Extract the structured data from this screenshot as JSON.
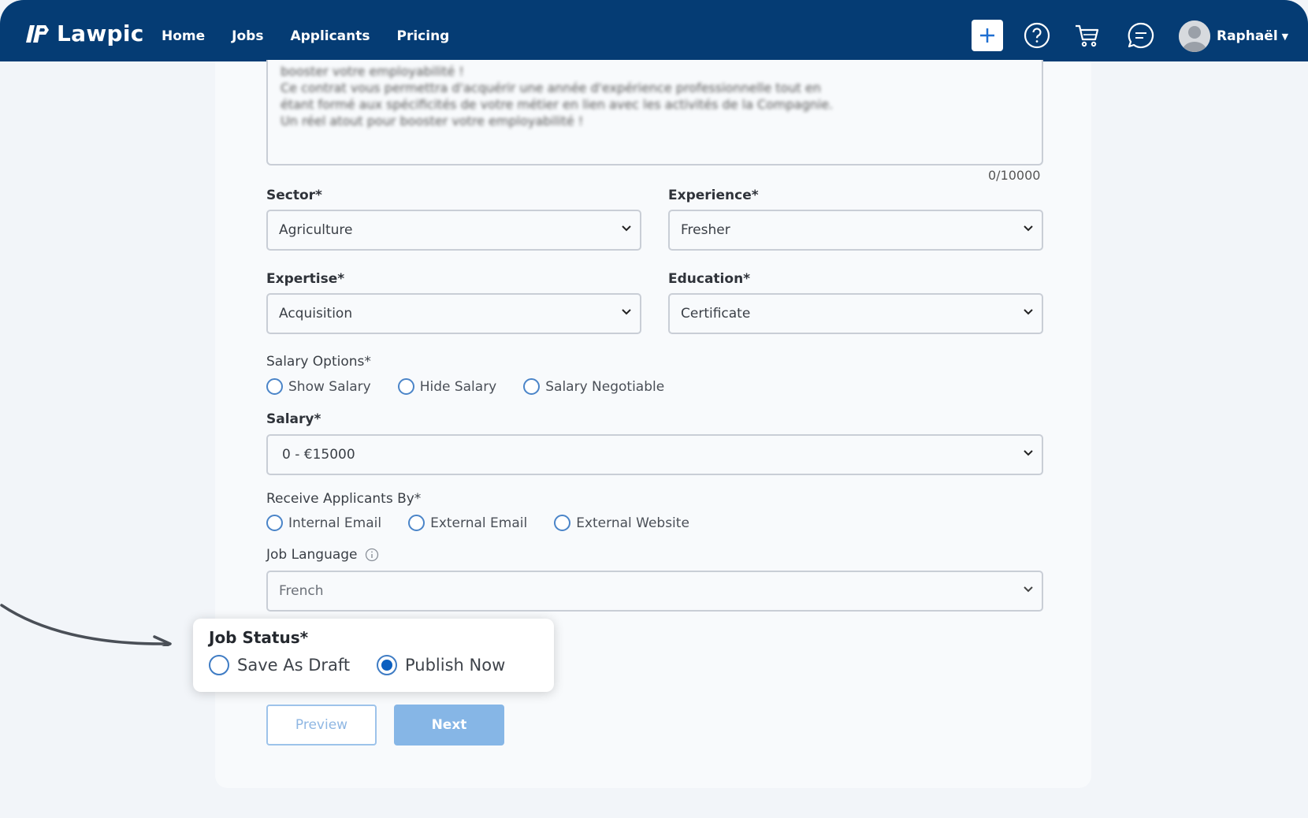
{
  "header": {
    "brand": "Lawpic",
    "nav": [
      "Home",
      "Jobs",
      "Applicants",
      "Pricing"
    ],
    "user_name": "Raphaël",
    "icons": [
      "plus-icon",
      "help-icon",
      "cart-icon",
      "chat-icon",
      "avatar-icon",
      "caret-down-icon"
    ]
  },
  "description": {
    "visible_text": "booster votre employabilité !\nCe contrat vous permettra d'acquérir une année d'expérience professionnelle tout en\nétant formé aux spécificités de votre métier en lien avec les activités de la Compagnie.\nUn réel atout pour booster votre employabilité !",
    "counter": "0/10000"
  },
  "form": {
    "sector": {
      "label": "Sector*",
      "value": "Agriculture"
    },
    "experience": {
      "label": "Experience*",
      "value": "Fresher"
    },
    "expertise": {
      "label": "Expertise*",
      "value": "Acquisition"
    },
    "education": {
      "label": "Education*",
      "value": "Certificate"
    },
    "salary_options": {
      "label": "Salary Options*",
      "options": [
        "Show Salary",
        "Hide Salary",
        "Salary Negotiable"
      ]
    },
    "salary": {
      "label": "Salary*",
      "value": "0 - €15000"
    },
    "receive_applicants": {
      "label": "Receive Applicants By*",
      "options": [
        "Internal Email",
        "External Email",
        "External Website"
      ]
    },
    "job_language": {
      "label": "Job Language",
      "value": "French"
    },
    "job_status": {
      "label": "Job Status*",
      "options": [
        "Save As Draft",
        "Publish Now"
      ],
      "selected": "Publish Now"
    }
  },
  "buttons": {
    "preview": "Preview",
    "next": "Next"
  },
  "colors": {
    "header_bg": "#053c74",
    "accent": "#0b5fc0",
    "next_bg": "#86b6e6"
  }
}
